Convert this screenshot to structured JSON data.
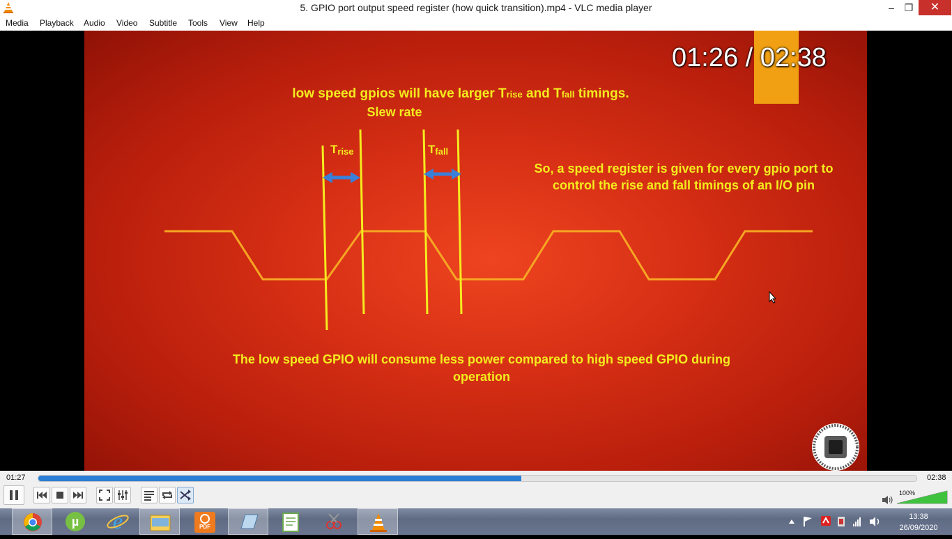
{
  "window": {
    "title": "5. GPIO port output speed register (how quick transition).mp4 - VLC media player",
    "minimize_glyph": "–",
    "maximize_glyph": "❐",
    "close_glyph": "✕"
  },
  "menu": {
    "items": [
      "Media",
      "Playback",
      "Audio",
      "Video",
      "Subtitle",
      "Tools",
      "View",
      "Help"
    ]
  },
  "video": {
    "timer_overlay": "01:26 / 02:38",
    "heading_line1": "low speed gpios will have larger T",
    "heading_rise": "rise",
    "heading_and": " and T",
    "heading_fall": "fall",
    "heading_end": " timings.",
    "heading_line2": "Slew rate",
    "label_trise_T": "T",
    "label_trise_sub": "rise",
    "label_tfall_T": "T",
    "label_tfall_sub": "fall",
    "right_text": "So, a speed register is given for every gpio port to control the rise and fall timings of an I/O pin",
    "bottom_text": "The low speed GPIO will consume less power compared to high speed GPIO during operation",
    "colors": {
      "text_yellow": "#f4ec1e",
      "wave_orange": "#f6a623",
      "slide_red": "#d62f14"
    }
  },
  "controls": {
    "current_time": "01:27",
    "total_time": "02:38",
    "seek_progress": 0.55,
    "volume_label": "100%",
    "volume_level": 1.0,
    "buttons": [
      "pause-icon",
      "previous-icon",
      "stop-icon",
      "next-icon",
      "fullscreen-icon",
      "extended-settings-icon",
      "playlist-icon",
      "loop-icon",
      "shuffle-icon"
    ]
  },
  "taskbar": {
    "apps": [
      "chrome-icon",
      "utorrent-icon",
      "internet-explorer-icon",
      "file-explorer-icon",
      "pdf-app-icon",
      "notepad-icon",
      "notepad-plus-plus-icon",
      "snipping-tool-icon",
      "vlc-icon"
    ],
    "clock_time": "13:38",
    "clock_date": "26/09/2020"
  }
}
